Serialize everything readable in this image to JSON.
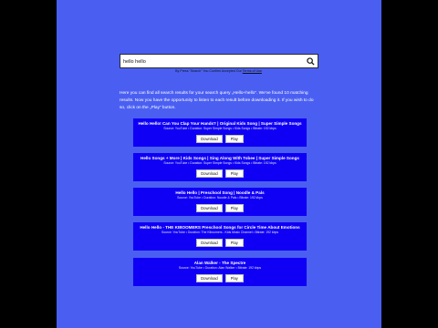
{
  "search": {
    "value": "hello hello",
    "terms_prefix": "By Press \"Search\" You Confirm Accepted Our ",
    "terms_link": "Terms of Use",
    "terms_suffix": "."
  },
  "intro_text": "Here you can find all search results for your search query „Hello+hello“. We've found 10 matching results. Now you have the opportunity to listen to each result before downloading it. If you wish to do so, click on the „Play“ button.",
  "results": [
    {
      "title": "Hello Hello! Can You Clap Your Hands? | Original Kids Song | Super Simple Songs",
      "meta": "Source: YouTube • Duration: Super Simple Songs • Kids Songs • Bitrate: 192 kbps",
      "download_label": "Download",
      "play_label": "Play"
    },
    {
      "title": "Hello Songs + More | Kids Songs | Sing Along With Tobee | Super Simple Songs",
      "meta": "Source: YouTube • Duration: Super Simple Songs • Kids Songs • Bitrate: 192 kbps",
      "download_label": "Download",
      "play_label": "Play"
    },
    {
      "title": "Hello Hello | Preschool Song | Noodle & Pals",
      "meta": "Source: YouTube • Duration: Noodle & Pals • Bitrate: 192 kbps",
      "download_label": "Download",
      "play_label": "Play"
    },
    {
      "title": "Hello Hello - THE KIBOOMERS Preschool Songs for Circle Time About Emotions",
      "meta": "Source: YouTube • Duration: The Kiboomers - Kids Music Channel • Bitrate: 192 kbps",
      "download_label": "Download",
      "play_label": "Play"
    },
    {
      "title": "Alan Walker - The Spectre",
      "meta": "Source: YouTube • Duration: Alan Walker • Bitrate: 192 kbps",
      "download_label": "Download",
      "play_label": "Play"
    }
  ],
  "colors": {
    "page_bg": "#4a5ff2",
    "result_bg": "#0f00f5",
    "outer_bg": "#000000"
  }
}
